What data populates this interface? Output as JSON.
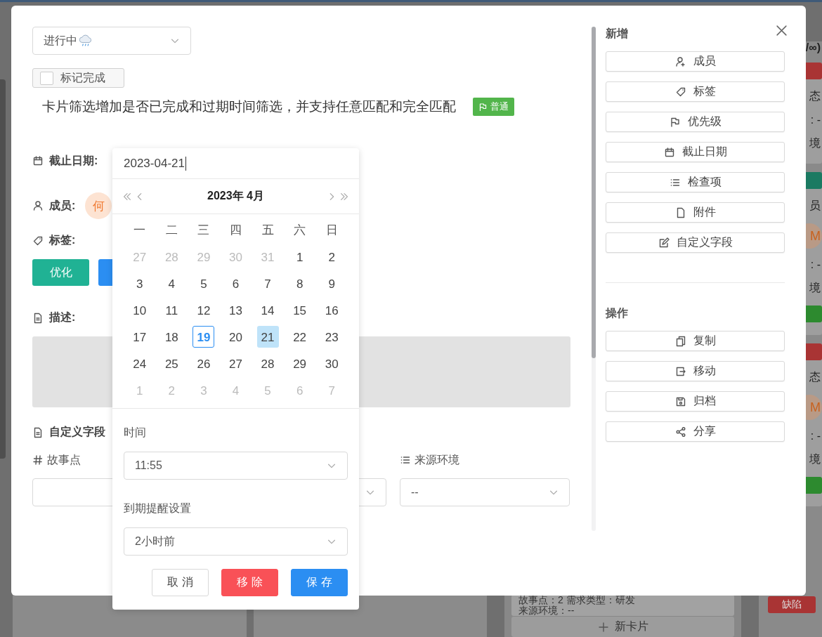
{
  "board": {
    "right_column": {
      "header": "/∞)",
      "cards": [
        {
          "items": [
            {
              "kind": "tag",
              "color": "#a93434"
            },
            {
              "kind": "text",
              "text": "态"
            },
            {
              "kind": "text",
              "text": ": -"
            },
            {
              "kind": "text",
              "text": "境"
            }
          ]
        },
        {
          "items": [
            {
              "kind": "tag",
              "color": "#1b7a62"
            },
            {
              "kind": "text",
              "text": "员"
            },
            {
              "kind": "avatar",
              "text": "M"
            },
            {
              "kind": "text",
              "text": ": -"
            },
            {
              "kind": "text",
              "text": "境"
            },
            {
              "kind": "tag",
              "color": "#2d8a2f"
            }
          ]
        },
        {
          "items": [
            {
              "kind": "tag",
              "color": "#a93434"
            },
            {
              "kind": "text",
              "text": "态"
            },
            {
              "kind": "avatar",
              "text": "M"
            },
            {
              "kind": "text",
              "text": ": -"
            },
            {
              "kind": "text",
              "text": "境"
            },
            {
              "kind": "tag",
              "color": "#2d8a2f"
            }
          ]
        }
      ]
    },
    "bottom_card": {
      "lines": [
        "故事点：2  需求类型：研发",
        "来源环境：--"
      ]
    },
    "new_card_button": "新卡片",
    "bottom_tag": {
      "label": "缺陷",
      "color": "#a93434"
    }
  },
  "dialog": {
    "status_select": {
      "value": "进行中"
    },
    "mark_done": {
      "label": "标记完成",
      "checked": false
    },
    "title": "卡片筛选增加是否已完成和过期时间筛选，并支持任意匹配和完全匹配",
    "priority": {
      "label": "普通",
      "color": "#52b54b"
    },
    "due_date": {
      "label": "截止日期:"
    },
    "members": {
      "label": "成员:",
      "avatars": [
        "何"
      ]
    },
    "tags": {
      "label": "标签:",
      "items": [
        {
          "label": "优化",
          "color": "#20b294"
        },
        {
          "color": "#2b8ef2"
        }
      ]
    },
    "description": {
      "label": "描述:"
    },
    "custom_fields": {
      "label": "自定义字段",
      "fields": [
        {
          "kind": "number",
          "label": "故事点"
        },
        {
          "kind": "select"
        },
        {
          "kind": "select",
          "label": "来源环境",
          "value": "--"
        }
      ]
    },
    "sidebar": [
      {
        "title": "新增",
        "buttons": [
          "成员",
          "标签",
          "优先级",
          "截止日期",
          "检查项",
          "附件",
          "自定义字段"
        ]
      },
      {
        "title": "操作",
        "buttons": [
          "复制",
          "移动",
          "归档",
          "分享"
        ]
      }
    ]
  },
  "date_picker": {
    "input_value": "2023-04-21",
    "header": "2023年 4月",
    "weekdays": [
      "一",
      "二",
      "三",
      "四",
      "五",
      "六",
      "日"
    ],
    "weeks": [
      [
        {
          "day": "27",
          "muted": true,
          "today": false,
          "selected": false
        },
        {
          "day": "28",
          "muted": true,
          "today": false,
          "selected": false
        },
        {
          "day": "29",
          "muted": true,
          "today": false,
          "selected": false
        },
        {
          "day": "30",
          "muted": true,
          "today": false,
          "selected": false
        },
        {
          "day": "31",
          "muted": true,
          "today": false,
          "selected": false
        },
        {
          "day": "1",
          "muted": false,
          "today": false,
          "selected": false
        },
        {
          "day": "2",
          "muted": false,
          "today": false,
          "selected": false
        }
      ],
      [
        {
          "day": "3",
          "muted": false,
          "today": false,
          "selected": false
        },
        {
          "day": "4",
          "muted": false,
          "today": false,
          "selected": false
        },
        {
          "day": "5",
          "muted": false,
          "today": false,
          "selected": false
        },
        {
          "day": "6",
          "muted": false,
          "today": false,
          "selected": false
        },
        {
          "day": "7",
          "muted": false,
          "today": false,
          "selected": false
        },
        {
          "day": "8",
          "muted": false,
          "today": false,
          "selected": false
        },
        {
          "day": "9",
          "muted": false,
          "today": false,
          "selected": false
        }
      ],
      [
        {
          "day": "10",
          "muted": false,
          "today": false,
          "selected": false
        },
        {
          "day": "11",
          "muted": false,
          "today": false,
          "selected": false
        },
        {
          "day": "12",
          "muted": false,
          "today": false,
          "selected": false
        },
        {
          "day": "13",
          "muted": false,
          "today": false,
          "selected": false
        },
        {
          "day": "14",
          "muted": false,
          "today": false,
          "selected": false
        },
        {
          "day": "15",
          "muted": false,
          "today": false,
          "selected": false
        },
        {
          "day": "16",
          "muted": false,
          "today": false,
          "selected": false
        }
      ],
      [
        {
          "day": "17",
          "muted": false,
          "today": false,
          "selected": false
        },
        {
          "day": "18",
          "muted": false,
          "today": false,
          "selected": false
        },
        {
          "day": "19",
          "muted": false,
          "today": true,
          "selected": false
        },
        {
          "day": "20",
          "muted": false,
          "today": false,
          "selected": false
        },
        {
          "day": "21",
          "muted": false,
          "today": false,
          "selected": true
        },
        {
          "day": "22",
          "muted": false,
          "today": false,
          "selected": false
        },
        {
          "day": "23",
          "muted": false,
          "today": false,
          "selected": false
        }
      ],
      [
        {
          "day": "24",
          "muted": false,
          "today": false,
          "selected": false
        },
        {
          "day": "25",
          "muted": false,
          "today": false,
          "selected": false
        },
        {
          "day": "26",
          "muted": false,
          "today": false,
          "selected": false
        },
        {
          "day": "27",
          "muted": false,
          "today": false,
          "selected": false
        },
        {
          "day": "28",
          "muted": false,
          "today": false,
          "selected": false
        },
        {
          "day": "29",
          "muted": false,
          "today": false,
          "selected": false
        },
        {
          "day": "30",
          "muted": false,
          "today": false,
          "selected": false
        }
      ],
      [
        {
          "day": "1",
          "muted": true,
          "today": false,
          "selected": false
        },
        {
          "day": "2",
          "muted": true,
          "today": false,
          "selected": false
        },
        {
          "day": "3",
          "muted": true,
          "today": false,
          "selected": false
        },
        {
          "day": "4",
          "muted": true,
          "today": false,
          "selected": false
        },
        {
          "day": "5",
          "muted": true,
          "today": false,
          "selected": false
        },
        {
          "day": "6",
          "muted": true,
          "today": false,
          "selected": false
        },
        {
          "day": "7",
          "muted": true,
          "today": false,
          "selected": false
        }
      ]
    ],
    "time_label": "时间",
    "time_value": "11:55",
    "reminder_label": "到期提醒设置",
    "reminder_value": "2小时前",
    "buttons": [
      {
        "kind": "default",
        "label": "取 消"
      },
      {
        "kind": "danger",
        "label": "移 除"
      },
      {
        "kind": "primary",
        "label": "保 存"
      }
    ]
  }
}
